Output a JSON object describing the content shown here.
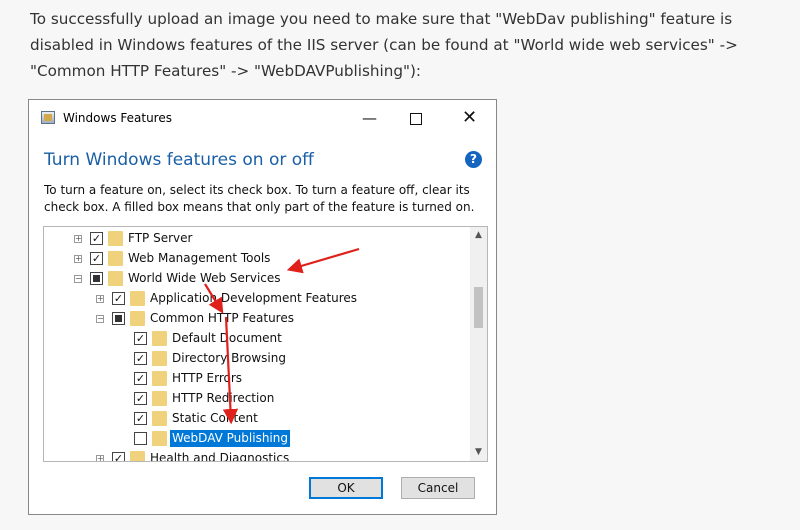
{
  "intro_text": "To successfully upload an image you need to make sure that \"WebDav publishing\" feature is disabled in Windows features of the IIS server (can be found at \"World wide web services\" -> \"Common HTTP Features\" -> \"WebDAVPublishing\"):",
  "dialog": {
    "title": "Windows Features",
    "controls": {
      "minimize": "—",
      "close": "✕"
    },
    "heading": "Turn Windows features on or off",
    "help": "?",
    "description": "To turn a feature on, select its check box. To turn a feature off, clear its check box. A filled box means that only part of the feature is turned on.",
    "tree_items": [
      {
        "label": "FTP Server",
        "expander": "+",
        "check": "✓"
      },
      {
        "label": "Web Management Tools",
        "expander": "+",
        "check": "✓"
      },
      {
        "label": "World Wide Web Services",
        "expander": "−",
        "check": "partial"
      },
      {
        "label": "Application Development Features",
        "expander": "+",
        "check": "✓"
      },
      {
        "label": "Common HTTP Features",
        "expander": "−",
        "check": "partial"
      },
      {
        "label": "Default Document",
        "check": "✓"
      },
      {
        "label": "Directory Browsing",
        "check": "✓"
      },
      {
        "label": "HTTP Errors",
        "check": "✓"
      },
      {
        "label": "HTTP Redirection",
        "check": "✓"
      },
      {
        "label": "Static Content",
        "check": "✓"
      },
      {
        "label": "WebDAV Publishing",
        "check": "",
        "selected": true
      },
      {
        "label": "Health and Diagnostics",
        "expander": "+",
        "check": "✓"
      }
    ],
    "scroll": {
      "up": "▲",
      "down": "▼"
    },
    "ok_label": "OK",
    "cancel_label": "Cancel"
  },
  "annotation_color": "#e0201b"
}
